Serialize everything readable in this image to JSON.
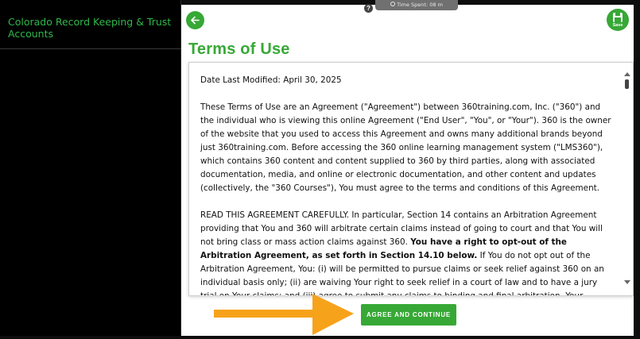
{
  "sidebar": {
    "course_title": "Colorado Record Keeping & Trust Accounts"
  },
  "header": {
    "help_label": "?",
    "timer_text": "Time Spent: 08 m",
    "save_label": "Save"
  },
  "main": {
    "title": "Terms of Use",
    "date_modified": "Date Last Modified: April 30, 2025",
    "paragraph_1": "These Terms of Use are an Agreement (\"Agreement\") between 360training.com, Inc. (\"360\") and the individual who is viewing this online Agreement (\"End User\", \"You\", or \"Your\"). 360 is the owner of the website that you used to access this Agreement and owns many additional brands beyond just 360training.com.  Before accessing the 360 online learning management system (\"LMS360\"), which contains 360 content and content supplied to 360 by third parties, along with associated documentation, media, and online or electronic documentation, and other content and updates (collectively, the \"360 Courses\"), You must agree to the terms and conditions of this Agreement.",
    "paragraph_2_start": "READ THIS AGREEMENT CAREFULLY.  In particular, Section 14 contains an Arbitration Agreement providing that You and 360 will arbitrate certain claims instead of going to court and that You will not bring class or mass action claims against 360. ",
    "paragraph_2_bold": "You have a right to opt-out of the Arbitration Agreement, as set forth in Section 14.10 below.",
    "paragraph_2_end": "  If You do not opt out of the Arbitration Agreement, You:  (i) will be permitted to pursue claims or seek relief against 360 on an individual basis only; (ii) are waiving Your right to seek relief in a court of law and to have a jury trial on Your claims; and (iii) agree to submit any claims to binding and final arbitration.  Your acceptance of this Agreement, including the",
    "agree_button": "AGREE AND CONTINUE"
  },
  "colors": {
    "accent_green": "#37a836",
    "sidebar_text_green": "#2fb84a",
    "arrow_orange": "#f7a21b"
  },
  "icons": [
    "back-arrow-icon",
    "help-icon",
    "clock-icon",
    "save-disk-icon",
    "scroll-up-icon",
    "scroll-down-icon",
    "pointer-arrow-icon"
  ]
}
